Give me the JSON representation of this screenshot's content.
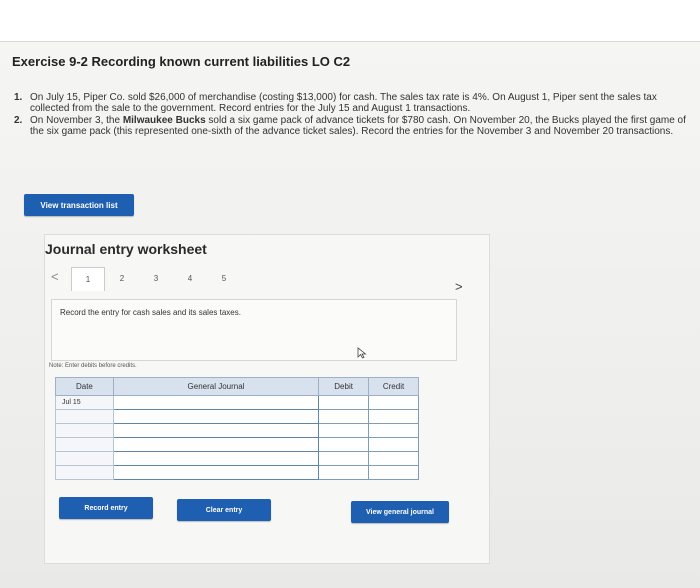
{
  "exercise": {
    "title": "Exercise 9-2 Recording known current liabilities LO C2",
    "problems": [
      {
        "number": "1.",
        "text": "On July 15, Piper Co. sold $26,000 of merchandise (costing $13,000) for cash. The sales tax rate is 4%. On August 1, Piper sent the sales tax collected from the sale to the government. Record entries for the July 15 and August 1 transactions."
      },
      {
        "number": "2.",
        "text_before": "On November 3, the ",
        "bold": "Milwaukee Bucks",
        "text_after": " sold a six game pack of advance tickets for $780 cash. On November 20, the Bucks played the first game of the six game pack (this represented one-sixth of the advance ticket sales). Record the entries for the November 3 and November 20 transactions."
      }
    ],
    "view_transaction_list_label": "View transaction list"
  },
  "worksheet": {
    "title": "Journal entry worksheet",
    "prev_label": "<",
    "next_label": ">",
    "tabs": [
      "1",
      "2",
      "3",
      "4",
      "5"
    ],
    "active_tab": "1",
    "instruction": "Record the entry for cash sales and its sales taxes.",
    "note": "Note: Enter debits before credits.",
    "table": {
      "headers": {
        "date": "Date",
        "general_journal": "General Journal",
        "debit": "Debit",
        "credit": "Credit"
      },
      "rows": [
        {
          "date": "Jul 15",
          "account": "",
          "debit": "",
          "credit": ""
        },
        {
          "date": "",
          "account": "",
          "debit": "",
          "credit": ""
        },
        {
          "date": "",
          "account": "",
          "debit": "",
          "credit": ""
        },
        {
          "date": "",
          "account": "",
          "debit": "",
          "credit": ""
        },
        {
          "date": "",
          "account": "",
          "debit": "",
          "credit": ""
        },
        {
          "date": "",
          "account": "",
          "debit": "",
          "credit": ""
        }
      ]
    },
    "buttons": {
      "record": "Record entry",
      "clear": "Clear entry",
      "view_journal": "View general journal"
    }
  },
  "colors": {
    "button_blue": "#1f5fb2",
    "table_header": "#d8e2ee",
    "table_border": "#7d9db9"
  },
  "icons": {
    "cursor": "mouse-pointer-icon"
  }
}
